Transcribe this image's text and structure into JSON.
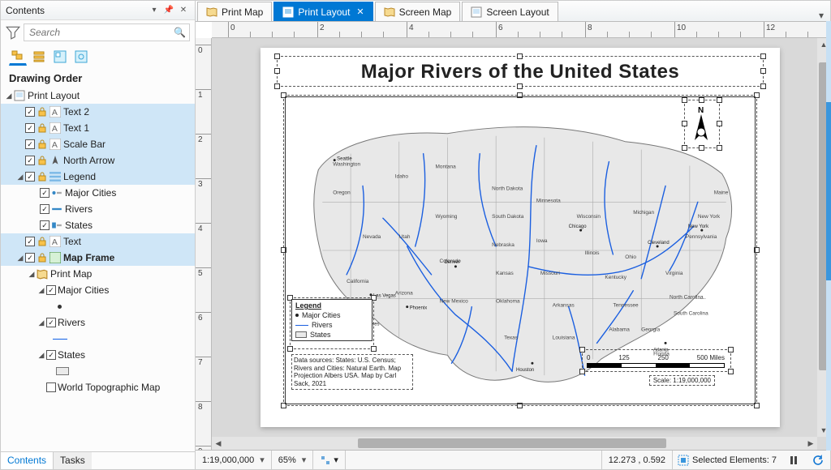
{
  "sidebar": {
    "title": "Contents",
    "search_placeholder": "Search",
    "section": "Drawing Order",
    "root": "Print Layout",
    "items": [
      {
        "label": "Text 2",
        "sel": true,
        "type": "A"
      },
      {
        "label": "Text 1",
        "sel": true,
        "type": "A"
      },
      {
        "label": "Scale Bar",
        "sel": true,
        "type": "A"
      },
      {
        "label": "North Arrow",
        "sel": true,
        "type": "N"
      },
      {
        "label": "Legend",
        "sel": true,
        "type": "L",
        "exp": true
      },
      {
        "label": "Major Cities",
        "child": true,
        "type": "pt"
      },
      {
        "label": "Rivers",
        "child": true,
        "type": "ln"
      },
      {
        "label": "States",
        "child": true,
        "type": "pg"
      },
      {
        "label": "Text",
        "sel": true,
        "type": "A"
      },
      {
        "label": "Map Frame",
        "sel": true,
        "type": "M",
        "exp": true,
        "bold": true
      }
    ],
    "map_section": "Print Map",
    "layers": [
      {
        "label": "Major Cities",
        "sym": "dot"
      },
      {
        "label": "Rivers",
        "sym": "line",
        "on": true
      },
      {
        "label": "States",
        "sym": "box",
        "on": true
      },
      {
        "label": "World Topographic Map",
        "on": false
      }
    ],
    "tabs": {
      "active": "Contents",
      "other": "Tasks"
    }
  },
  "viewtabs": [
    {
      "label": "Print Map",
      "icon": "map",
      "active": false
    },
    {
      "label": "Print Layout",
      "icon": "layout",
      "active": true
    },
    {
      "label": "Screen Map",
      "icon": "map",
      "active": false
    },
    {
      "label": "Screen Layout",
      "icon": "layout",
      "active": false
    }
  ],
  "layout": {
    "title": "Major Rivers of the United States",
    "legend": {
      "heading": "Legend",
      "rows": [
        "Major Cities",
        "Rivers",
        "States"
      ]
    },
    "source": "Data sources: States: U.S. Census; Rivers and Cities: Natural Earth. Map Projection Albers USA. Map by Carl Sack, 2021",
    "scalebar": {
      "ticks": [
        "0",
        "125",
        "250",
        "500 Miles"
      ]
    },
    "scaletext": "Scale: 1:19,000,000",
    "ruler_units": [
      "0",
      "2",
      "4",
      "6",
      "8",
      "10",
      "12"
    ]
  },
  "status": {
    "scale": "1:19,000,000",
    "zoom": "65%",
    "coords": "12.273 , 0.592",
    "selected_label": "Selected Elements: 7"
  }
}
